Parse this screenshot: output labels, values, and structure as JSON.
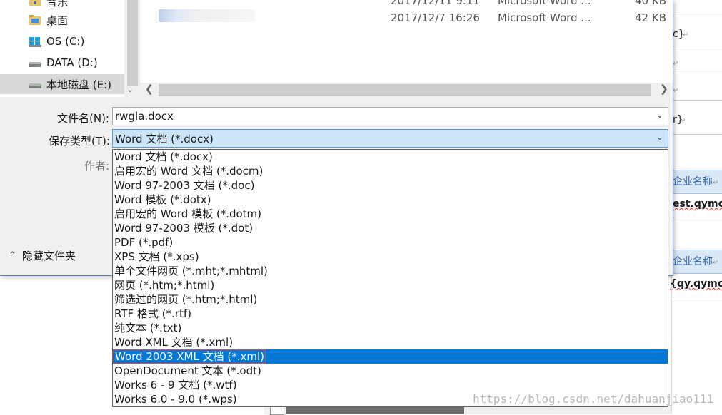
{
  "nav": {
    "items": [
      {
        "label": "音乐",
        "icon": "music-folder-icon"
      },
      {
        "label": "桌面",
        "icon": "desktop-folder-icon"
      },
      {
        "label": "OS (C:)",
        "icon": "windows-drive-icon"
      },
      {
        "label": "DATA (D:)",
        "icon": "drive-icon"
      },
      {
        "label": "本地磁盘 (E:)",
        "icon": "drive-icon"
      }
    ]
  },
  "files": [
    {
      "date": "2017/12/11 9:11",
      "type": "Microsoft Word ...",
      "size": "40 KB"
    },
    {
      "date": "2017/12/7 16:26",
      "type": "Microsoft Word ...",
      "size": "42 KB"
    }
  ],
  "form": {
    "filename_label": "文件名(N):",
    "filename_value": "rwgla.docx",
    "savetype_label": "保存类型(T):",
    "savetype_value": "Word 文档 (*.docx)",
    "author_label": "作者:",
    "hide_folders_label": "隐藏文件夹"
  },
  "dropdown": {
    "options": [
      "Word 文档 (*.docx)",
      "启用宏的 Word 文档 (*.docm)",
      "Word 97-2003 文档 (*.doc)",
      "Word 模板 (*.dotx)",
      "启用宏的 Word 模板 (*.dotm)",
      "Word 97-2003 模板 (*.dot)",
      "PDF (*.pdf)",
      "XPS 文档 (*.xps)",
      "单个文件网页 (*.mht;*.mhtml)",
      "网页 (*.htm;*.html)",
      "筛选过的网页 (*.htm;*.html)",
      "RTF 格式 (*.rtf)",
      "纯文本 (*.txt)",
      "Word XML 文档 (*.xml)",
      "Word 2003 XML 文档 (*.xml)",
      "OpenDocument 文本 (*.odt)",
      "Works 6 - 9 文档 (*.wtf)",
      "Works 6.0 - 9.0 (*.wps)"
    ],
    "selected_index": 14
  },
  "doc_background": {
    "cell1": "企业名称",
    "cell1_value": "est.qymc}",
    "cell2": "企业名称",
    "cell2_value": "{qy.qymc}",
    "frag1": "c}",
    "frag2": "r}"
  },
  "watermark": "https://blog.csdn.net/dahuanjiao111",
  "colors": {
    "accent": "#0078d7",
    "dialog_border": "#5b87c7",
    "selection_outline": "#e04848"
  }
}
